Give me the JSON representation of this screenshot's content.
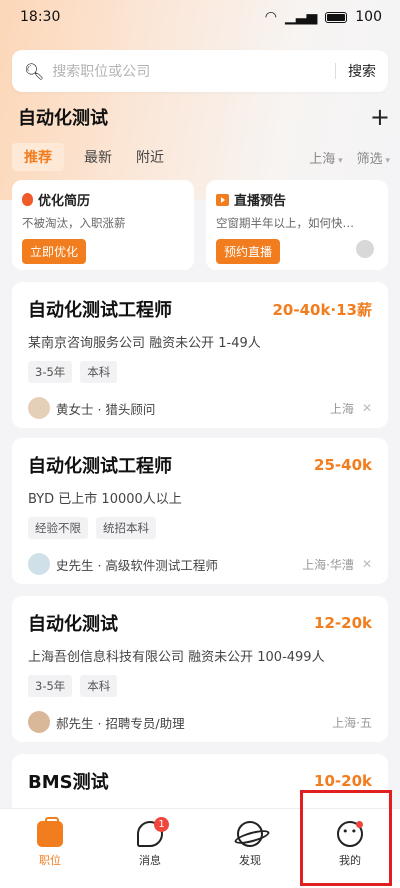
{
  "status": {
    "time": "18:30",
    "battery": "100"
  },
  "search": {
    "placeholder": "搜索职位或公司",
    "button": "搜索"
  },
  "header": {
    "title": "自动化测试",
    "add": "+"
  },
  "tabs": [
    {
      "label": "推荐",
      "active": true
    },
    {
      "label": "最新",
      "active": false
    },
    {
      "label": "附近",
      "active": false
    }
  ],
  "filters": {
    "city": "上海",
    "filter": "筛选"
  },
  "promos": [
    {
      "title": "优化简历",
      "subtitle": "不被淘汰，入职涨薪",
      "button": "立即优化",
      "icon": "flame-icon"
    },
    {
      "title": "直播预告",
      "subtitle": "空窗期半年以上，如何快…",
      "button": "预约直播",
      "icon": "live-icon"
    }
  ],
  "jobs": [
    {
      "title": "自动化测试工程师",
      "salary": "20-40k·13薪",
      "company": "某南京咨询服务公司  融资未公开  1-49人",
      "tags": [
        "3-5年",
        "本科"
      ],
      "recruiter": "黄女士 · 猎头顾问",
      "location": "上海"
    },
    {
      "title": "自动化测试工程师",
      "salary": "25-40k",
      "company": "BYD  已上市  10000人以上",
      "tags": [
        "经验不限",
        "统招本科"
      ],
      "recruiter": "史先生 · 高级软件测试工程师",
      "location": "上海·华漕"
    },
    {
      "title": "自动化测试",
      "salary": "12-20k",
      "company": "上海吾创信息科技有限公司  融资未公开  100-499人",
      "tags": [
        "3-5年",
        "本科"
      ],
      "recruiter": "郝先生 · 招聘专员/助理",
      "location": "上海·五"
    },
    {
      "title": "BMS测试",
      "salary": "10-20k"
    }
  ],
  "nav": [
    {
      "label": "职位",
      "icon": "briefcase-icon",
      "active": true
    },
    {
      "label": "消息",
      "icon": "chat-icon",
      "badge": "1"
    },
    {
      "label": "发现",
      "icon": "planet-icon"
    },
    {
      "label": "我的",
      "icon": "face-icon",
      "dot": true
    }
  ],
  "colors": {
    "accent": "#f17d1f",
    "badge": "#f0463c"
  }
}
